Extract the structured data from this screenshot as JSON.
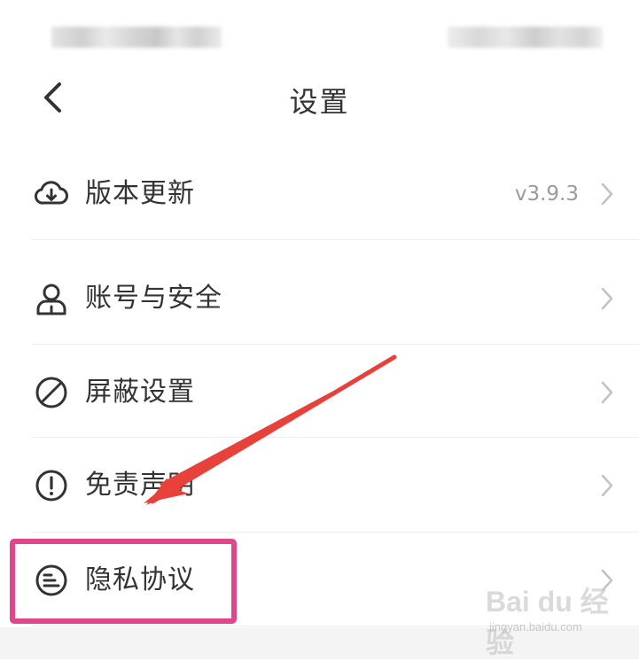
{
  "header": {
    "title": "设置"
  },
  "settings": {
    "items": [
      {
        "label": "版本更新",
        "value": "v3.9.3",
        "icon": "cloud-download-icon"
      },
      {
        "label": "账号与安全",
        "value": "",
        "icon": "user-icon"
      },
      {
        "label": "屏蔽设置",
        "value": "",
        "icon": "block-icon"
      },
      {
        "label": "免责声明",
        "value": "",
        "icon": "alert-circle-icon"
      },
      {
        "label": "隐私协议",
        "value": "",
        "icon": "document-circle-icon"
      }
    ]
  },
  "annotation": {
    "highlight_color": "#e0468a",
    "arrow_color": "#e8413a"
  },
  "watermark": {
    "brand": "Bai du 经验",
    "url": "jingyan.baidu.com"
  }
}
